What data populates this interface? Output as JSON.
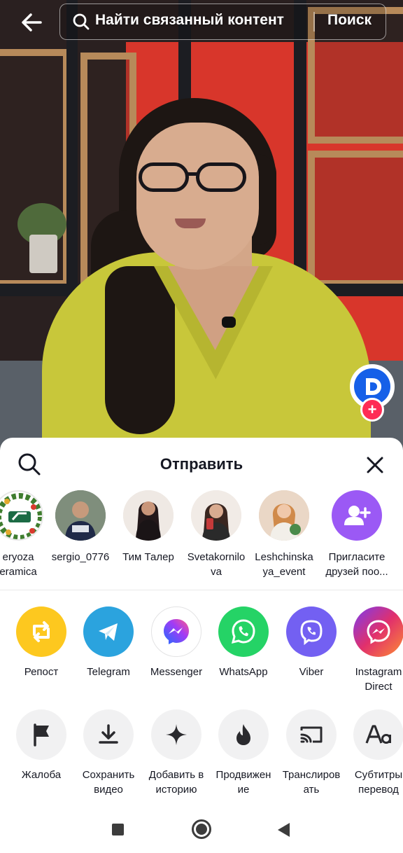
{
  "top_bar": {
    "search_placeholder": "Найти связанный контент",
    "search_button": "Поиск"
  },
  "share_sheet": {
    "title": "Отправить",
    "contacts": [
      {
        "name": "eryoza\neramica"
      },
      {
        "name": "sergio_0776"
      },
      {
        "name": "Тим Талер"
      },
      {
        "name": "Svetakornilo\nva"
      },
      {
        "name": "Leshchinska\nya_event"
      },
      {
        "name": "Пригласите\nдрузей поо..."
      }
    ],
    "apps": [
      {
        "label": "Репост",
        "color": "#fdc81f"
      },
      {
        "label": "Telegram",
        "color": "#2ba3de"
      },
      {
        "label": "Messenger",
        "color": "#ffffff"
      },
      {
        "label": "WhatsApp",
        "color": "#25d366"
      },
      {
        "label": "Viber",
        "color": "#7360f2"
      },
      {
        "label": "Instagram\nDirect",
        "color": "#e1306c"
      }
    ],
    "actions": [
      {
        "label": "Жалоба"
      },
      {
        "label": "Сохранить\nвидео"
      },
      {
        "label": "Добавить в\nисторию"
      },
      {
        "label": "Продвижен\nие"
      },
      {
        "label": "Транслиров\nать"
      },
      {
        "label": "Субтитры\nперевод"
      }
    ]
  },
  "colors": {
    "accent": "#fe2c55",
    "invite": "#9b59f5"
  }
}
